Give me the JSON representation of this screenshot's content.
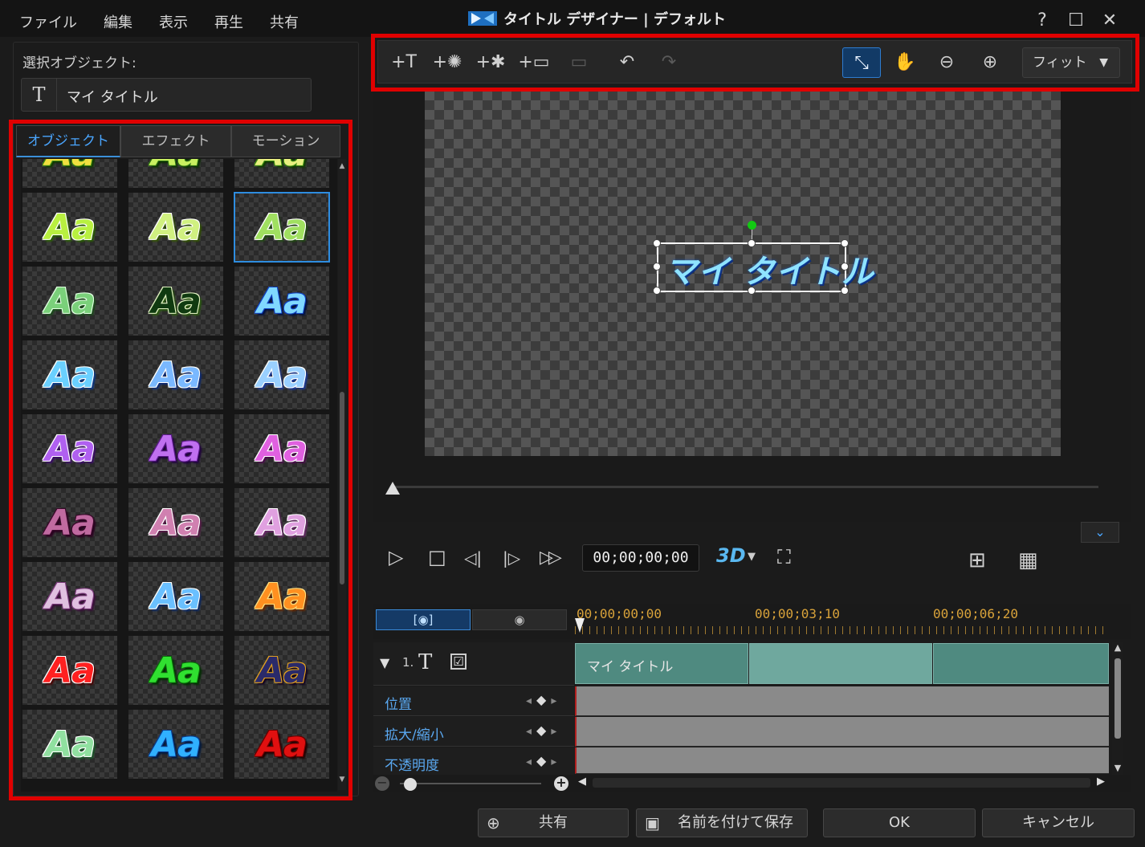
{
  "menu": [
    "ファイル",
    "編集",
    "表示",
    "再生",
    "共有"
  ],
  "window": {
    "title": "タイトル デザイナー | デフォルト",
    "help": "?",
    "maximize": "☐",
    "close": "✕"
  },
  "selected_object": {
    "label": "選択オブジェクト:",
    "icon": "T",
    "name": "マイ タイトル"
  },
  "tabs": [
    {
      "label": "オブジェクト",
      "active": true
    },
    {
      "label": "エフェクト",
      "active": false
    },
    {
      "label": "モーション",
      "active": false
    }
  ],
  "template_grid": {
    "sample_text": "Aa",
    "selected_index": 5,
    "cells": [
      {
        "fill": "#f0e040",
        "stroke": "#3a8a10",
        "shadow": "#103a00"
      },
      {
        "fill": "#c8f060",
        "stroke": "#2a7010",
        "shadow": "#0a3000"
      },
      {
        "fill": "#e8f080",
        "stroke": "#3a8a10",
        "shadow": "#103a00"
      },
      {
        "fill": "#b8f040",
        "stroke": "#ffffff",
        "shadow": "#2a6000"
      },
      {
        "fill": "#d0f080",
        "stroke": "#ffffff",
        "shadow": "#335500"
      },
      {
        "fill": "#a0e060",
        "stroke": "#ffffff",
        "shadow": "#204a10"
      },
      {
        "fill": "#7ad07a",
        "stroke": "#e0ffe0",
        "shadow": "#1a4a1a"
      },
      {
        "fill": "#103a10",
        "stroke": "#e0f0c0",
        "shadow": "#2a5a10"
      },
      {
        "fill": "#80d8ff",
        "stroke": "#1040c0",
        "shadow": "#001040"
      },
      {
        "fill": "#6ad0ff",
        "stroke": "#ffffff",
        "shadow": "#0a3a8a"
      },
      {
        "fill": "#7ab8ff",
        "stroke": "#ffffff",
        "shadow": "#0a2a7a"
      },
      {
        "fill": "#9ad0ff",
        "stroke": "#ffffff",
        "shadow": "#1a3a9a"
      },
      {
        "fill": "#b060f0",
        "stroke": "#ffffff",
        "shadow": "#3a0a6a"
      },
      {
        "fill": "#c070f0",
        "stroke": "#5a1a8a",
        "shadow": "#200040"
      },
      {
        "fill": "#e060e0",
        "stroke": "#ffffff",
        "shadow": "#4a0a4a"
      },
      {
        "fill": "#c06aa0",
        "stroke": "#3a0a2a",
        "shadow": "#2a0020"
      },
      {
        "fill": "#d080b0",
        "stroke": "#ffffff",
        "shadow": "#5a1a4a"
      },
      {
        "fill": "#e0a0e0",
        "stroke": "#ffffff",
        "shadow": "#6a2a6a"
      },
      {
        "fill": "#e0c0e0",
        "stroke": "#7a3a7a",
        "shadow": "#3a103a"
      },
      {
        "fill": "#6ac0ff",
        "stroke": "#ffffff",
        "shadow": "#0a2a6a"
      },
      {
        "fill": "#ff9020",
        "stroke": "#ffe080",
        "shadow": "#6a2a00"
      },
      {
        "fill": "#ff2020",
        "stroke": "#ffffff",
        "shadow": "#4a0000"
      },
      {
        "fill": "#30e030",
        "stroke": "#0a6a0a",
        "shadow": "#003000"
      },
      {
        "fill": "#2a2a6a",
        "stroke": "#e0a020",
        "shadow": "#100020"
      },
      {
        "fill": "#90e0a0",
        "stroke": "#ffffff",
        "shadow": "#1a5a2a"
      },
      {
        "fill": "#30b0ff",
        "stroke": "#0a3a8a",
        "shadow": "#001a40"
      },
      {
        "fill": "#e01010",
        "stroke": "#6a0000",
        "shadow": "#200000"
      }
    ]
  },
  "toolbar": {
    "buttons": [
      {
        "icon": "insert-text-icon",
        "glyph": "+T",
        "state": "normal"
      },
      {
        "icon": "insert-particle-icon",
        "glyph": "+✺",
        "state": "normal"
      },
      {
        "icon": "insert-effect-icon",
        "glyph": "+✱",
        "state": "normal"
      },
      {
        "icon": "insert-image-icon",
        "glyph": "+▭",
        "state": "normal"
      },
      {
        "icon": "insert-background-icon",
        "glyph": "▭",
        "state": "disabled"
      },
      {
        "icon": "undo-icon",
        "glyph": "↶",
        "state": "normal"
      },
      {
        "icon": "redo-icon",
        "glyph": "↷",
        "state": "disabled"
      },
      {
        "icon": "select-move-icon",
        "glyph": "⤡",
        "state": "active"
      },
      {
        "icon": "pan-hand-icon",
        "glyph": "✋",
        "state": "normal"
      },
      {
        "icon": "zoom-out-icon",
        "glyph": "⊖",
        "state": "normal"
      },
      {
        "icon": "zoom-in-icon",
        "glyph": "⊕",
        "state": "normal"
      }
    ],
    "zoom_select": "フィット",
    "zoom_arrow": "▼"
  },
  "preview": {
    "title_text": "マイ タイトル",
    "playback_position": 0
  },
  "transport": {
    "play": "▷",
    "stop": "□",
    "prev_frame": "◁|",
    "next_frame": "|▷",
    "fast_forward": "▷▷",
    "timecode": "00;00;00;00",
    "mode_3d": "3D",
    "mode_3d_arrow": "▼",
    "fullscreen": "⛶",
    "safe_zone": "⊞",
    "grid": "▦",
    "expand": "⌄"
  },
  "timeline": {
    "view_buttons": [
      {
        "label": "[◉]",
        "active": true
      },
      {
        "label": "◉",
        "active": false
      }
    ],
    "ruler_marks": [
      "00;00;00;00",
      "00;00;03;10",
      "00;00;06;20"
    ],
    "track": {
      "expand": "▼",
      "number": "1.",
      "type_icon": "T",
      "enabled": "☑",
      "clip_label": "マイ タイトル"
    },
    "params": [
      {
        "label": "位置"
      },
      {
        "label": "拡大/縮小"
      },
      {
        "label": "不透明度"
      }
    ],
    "zoom_level": 0.05,
    "zoom_minus": "−",
    "zoom_plus": "+",
    "scroll_left": "◀",
    "scroll_right": "▶",
    "scroll_up": "▲",
    "scroll_down": "▼"
  },
  "bottom_buttons": {
    "share": "共有",
    "save_as": "名前を付けて保存",
    "ok": "OK",
    "cancel": "キャンセル"
  },
  "colors": {
    "highlight_frame": "#e00000",
    "accent": "#2e8de0",
    "clip": "#5f9e94"
  }
}
